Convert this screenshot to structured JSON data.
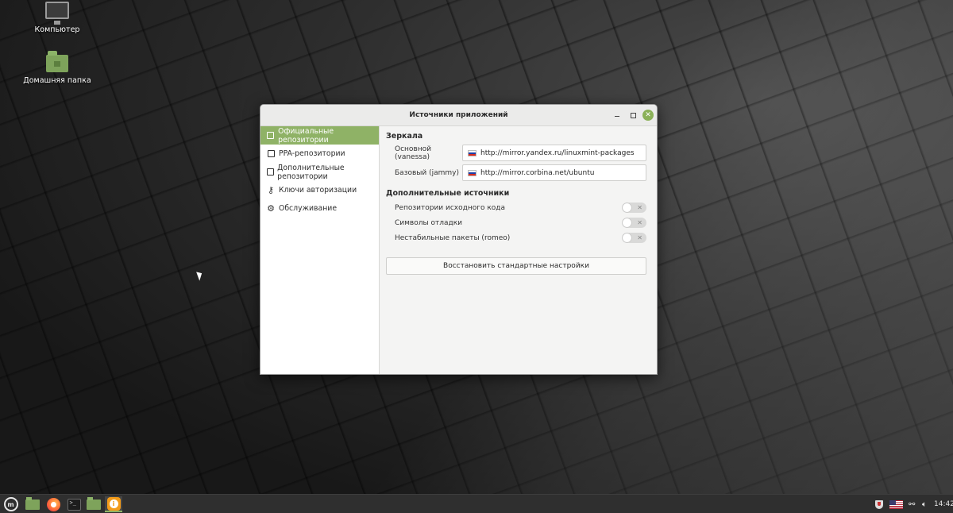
{
  "desktop": {
    "icons": [
      {
        "label": "Компьютер",
        "icon": "computer-icon"
      },
      {
        "label": "Домашняя папка",
        "icon": "home-folder-icon"
      }
    ]
  },
  "window": {
    "title": "Источники приложений",
    "sidebar": {
      "items": [
        {
          "label": "Официальные репозитории",
          "icon": "package-icon",
          "active": true
        },
        {
          "label": "PPA-репозитории",
          "icon": "package-icon",
          "active": false
        },
        {
          "label": "Дополнительные репозитории",
          "icon": "package-icon",
          "active": false
        },
        {
          "label": "Ключи авторизации",
          "icon": "key-icon",
          "active": false
        },
        {
          "label": "Обслуживание",
          "icon": "gear-icon",
          "active": false
        }
      ]
    },
    "mirrors": {
      "title": "Зеркала",
      "main_label": "Основной (vanessa)",
      "main_url": "http://mirror.yandex.ru/linuxmint-packages",
      "base_label": "Базовый (jammy)",
      "base_url": "http://mirror.corbina.net/ubuntu"
    },
    "optional": {
      "title": "Дополнительные источники",
      "items": [
        {
          "label": "Репозитории исходного кода",
          "enabled": false
        },
        {
          "label": "Символы отладки",
          "enabled": false
        },
        {
          "label": "Нестабильные пакеты (romeo)",
          "enabled": false
        }
      ]
    },
    "restore_label": "Восстановить стандартные настройки"
  },
  "panel": {
    "clock": "14:42",
    "colors": {
      "accent": "#8fb266"
    }
  }
}
